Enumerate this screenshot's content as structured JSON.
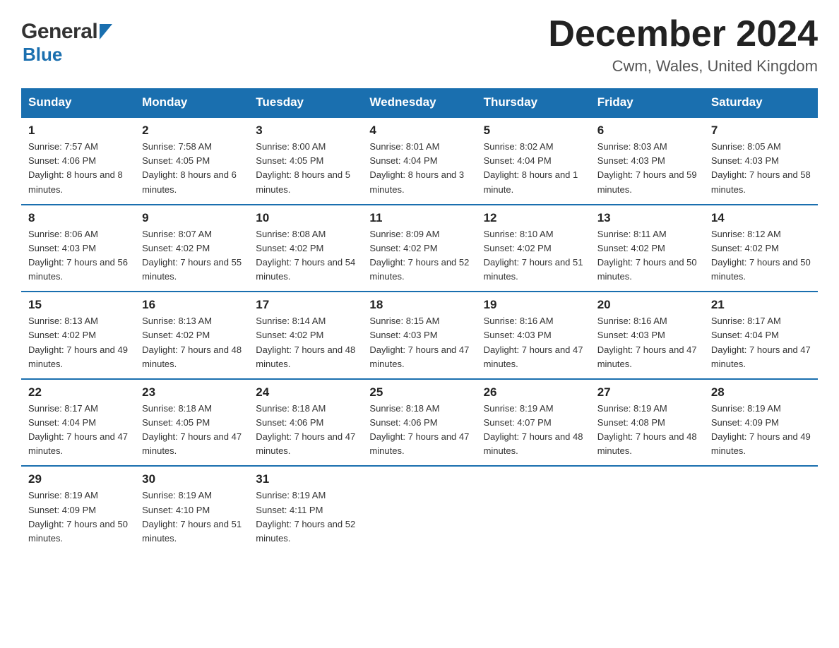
{
  "header": {
    "title": "December 2024",
    "location": "Cwm, Wales, United Kingdom",
    "logo_general": "General",
    "logo_blue": "Blue"
  },
  "columns": [
    "Sunday",
    "Monday",
    "Tuesday",
    "Wednesday",
    "Thursday",
    "Friday",
    "Saturday"
  ],
  "weeks": [
    [
      {
        "day": "1",
        "sunrise": "7:57 AM",
        "sunset": "4:06 PM",
        "daylight": "8 hours and 8 minutes."
      },
      {
        "day": "2",
        "sunrise": "7:58 AM",
        "sunset": "4:05 PM",
        "daylight": "8 hours and 6 minutes."
      },
      {
        "day": "3",
        "sunrise": "8:00 AM",
        "sunset": "4:05 PM",
        "daylight": "8 hours and 5 minutes."
      },
      {
        "day": "4",
        "sunrise": "8:01 AM",
        "sunset": "4:04 PM",
        "daylight": "8 hours and 3 minutes."
      },
      {
        "day": "5",
        "sunrise": "8:02 AM",
        "sunset": "4:04 PM",
        "daylight": "8 hours and 1 minute."
      },
      {
        "day": "6",
        "sunrise": "8:03 AM",
        "sunset": "4:03 PM",
        "daylight": "7 hours and 59 minutes."
      },
      {
        "day": "7",
        "sunrise": "8:05 AM",
        "sunset": "4:03 PM",
        "daylight": "7 hours and 58 minutes."
      }
    ],
    [
      {
        "day": "8",
        "sunrise": "8:06 AM",
        "sunset": "4:03 PM",
        "daylight": "7 hours and 56 minutes."
      },
      {
        "day": "9",
        "sunrise": "8:07 AM",
        "sunset": "4:02 PM",
        "daylight": "7 hours and 55 minutes."
      },
      {
        "day": "10",
        "sunrise": "8:08 AM",
        "sunset": "4:02 PM",
        "daylight": "7 hours and 54 minutes."
      },
      {
        "day": "11",
        "sunrise": "8:09 AM",
        "sunset": "4:02 PM",
        "daylight": "7 hours and 52 minutes."
      },
      {
        "day": "12",
        "sunrise": "8:10 AM",
        "sunset": "4:02 PM",
        "daylight": "7 hours and 51 minutes."
      },
      {
        "day": "13",
        "sunrise": "8:11 AM",
        "sunset": "4:02 PM",
        "daylight": "7 hours and 50 minutes."
      },
      {
        "day": "14",
        "sunrise": "8:12 AM",
        "sunset": "4:02 PM",
        "daylight": "7 hours and 50 minutes."
      }
    ],
    [
      {
        "day": "15",
        "sunrise": "8:13 AM",
        "sunset": "4:02 PM",
        "daylight": "7 hours and 49 minutes."
      },
      {
        "day": "16",
        "sunrise": "8:13 AM",
        "sunset": "4:02 PM",
        "daylight": "7 hours and 48 minutes."
      },
      {
        "day": "17",
        "sunrise": "8:14 AM",
        "sunset": "4:02 PM",
        "daylight": "7 hours and 48 minutes."
      },
      {
        "day": "18",
        "sunrise": "8:15 AM",
        "sunset": "4:03 PM",
        "daylight": "7 hours and 47 minutes."
      },
      {
        "day": "19",
        "sunrise": "8:16 AM",
        "sunset": "4:03 PM",
        "daylight": "7 hours and 47 minutes."
      },
      {
        "day": "20",
        "sunrise": "8:16 AM",
        "sunset": "4:03 PM",
        "daylight": "7 hours and 47 minutes."
      },
      {
        "day": "21",
        "sunrise": "8:17 AM",
        "sunset": "4:04 PM",
        "daylight": "7 hours and 47 minutes."
      }
    ],
    [
      {
        "day": "22",
        "sunrise": "8:17 AM",
        "sunset": "4:04 PM",
        "daylight": "7 hours and 47 minutes."
      },
      {
        "day": "23",
        "sunrise": "8:18 AM",
        "sunset": "4:05 PM",
        "daylight": "7 hours and 47 minutes."
      },
      {
        "day": "24",
        "sunrise": "8:18 AM",
        "sunset": "4:06 PM",
        "daylight": "7 hours and 47 minutes."
      },
      {
        "day": "25",
        "sunrise": "8:18 AM",
        "sunset": "4:06 PM",
        "daylight": "7 hours and 47 minutes."
      },
      {
        "day": "26",
        "sunrise": "8:19 AM",
        "sunset": "4:07 PM",
        "daylight": "7 hours and 48 minutes."
      },
      {
        "day": "27",
        "sunrise": "8:19 AM",
        "sunset": "4:08 PM",
        "daylight": "7 hours and 48 minutes."
      },
      {
        "day": "28",
        "sunrise": "8:19 AM",
        "sunset": "4:09 PM",
        "daylight": "7 hours and 49 minutes."
      }
    ],
    [
      {
        "day": "29",
        "sunrise": "8:19 AM",
        "sunset": "4:09 PM",
        "daylight": "7 hours and 50 minutes."
      },
      {
        "day": "30",
        "sunrise": "8:19 AM",
        "sunset": "4:10 PM",
        "daylight": "7 hours and 51 minutes."
      },
      {
        "day": "31",
        "sunrise": "8:19 AM",
        "sunset": "4:11 PM",
        "daylight": "7 hours and 52 minutes."
      },
      {
        "day": "",
        "sunrise": "",
        "sunset": "",
        "daylight": ""
      },
      {
        "day": "",
        "sunrise": "",
        "sunset": "",
        "daylight": ""
      },
      {
        "day": "",
        "sunrise": "",
        "sunset": "",
        "daylight": ""
      },
      {
        "day": "",
        "sunrise": "",
        "sunset": "",
        "daylight": ""
      }
    ]
  ],
  "labels": {
    "sunrise": "Sunrise:",
    "sunset": "Sunset:",
    "daylight": "Daylight:"
  },
  "colors": {
    "header_bg": "#1a6faf",
    "header_text": "#ffffff",
    "border": "#1a6faf"
  }
}
